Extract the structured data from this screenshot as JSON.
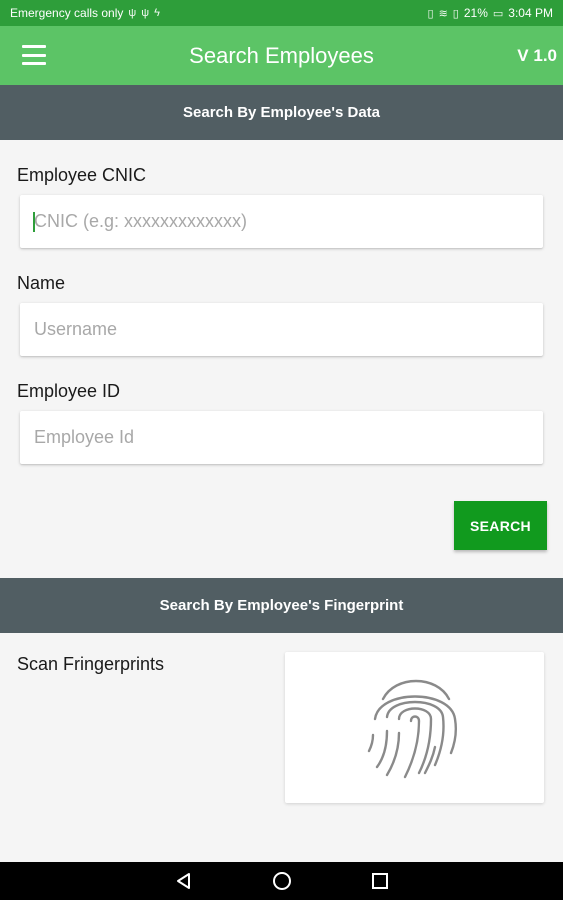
{
  "status_bar": {
    "carrier": "Emergency calls only",
    "battery": "21%",
    "time": "3:04 PM",
    "icons": [
      "usb-icon",
      "usb-icon",
      "bolt-icon",
      "vibrate-icon",
      "wifi-icon",
      "sim-icon",
      "battery-icon"
    ]
  },
  "app_bar": {
    "title": "Search Employees",
    "version": "V 1.0",
    "menu_icon": "hamburger-icon"
  },
  "data_section": {
    "header": "Search By Employee's Data",
    "cnic": {
      "label": "Employee CNIC",
      "placeholder": "CNIC (e.g: xxxxxxxxxxxxx)",
      "value": ""
    },
    "name": {
      "label": "Name",
      "placeholder": "Username",
      "value": ""
    },
    "employee_id": {
      "label": "Employee ID",
      "placeholder": "Employee Id",
      "value": ""
    },
    "search_button": "SEARCH"
  },
  "fingerprint_section": {
    "header": "Search By Employee's Fingerprint",
    "label": "Scan Fringerprints",
    "icon": "fingerprint-icon"
  },
  "nav_bar": {
    "buttons": [
      "back-icon",
      "home-icon",
      "recents-icon"
    ]
  },
  "colors": {
    "status_bar": "#2e9e3a",
    "app_bar": "#5cc466",
    "section_header": "#515e63",
    "search_button": "#119a1e",
    "background": "#f5f5f5"
  }
}
